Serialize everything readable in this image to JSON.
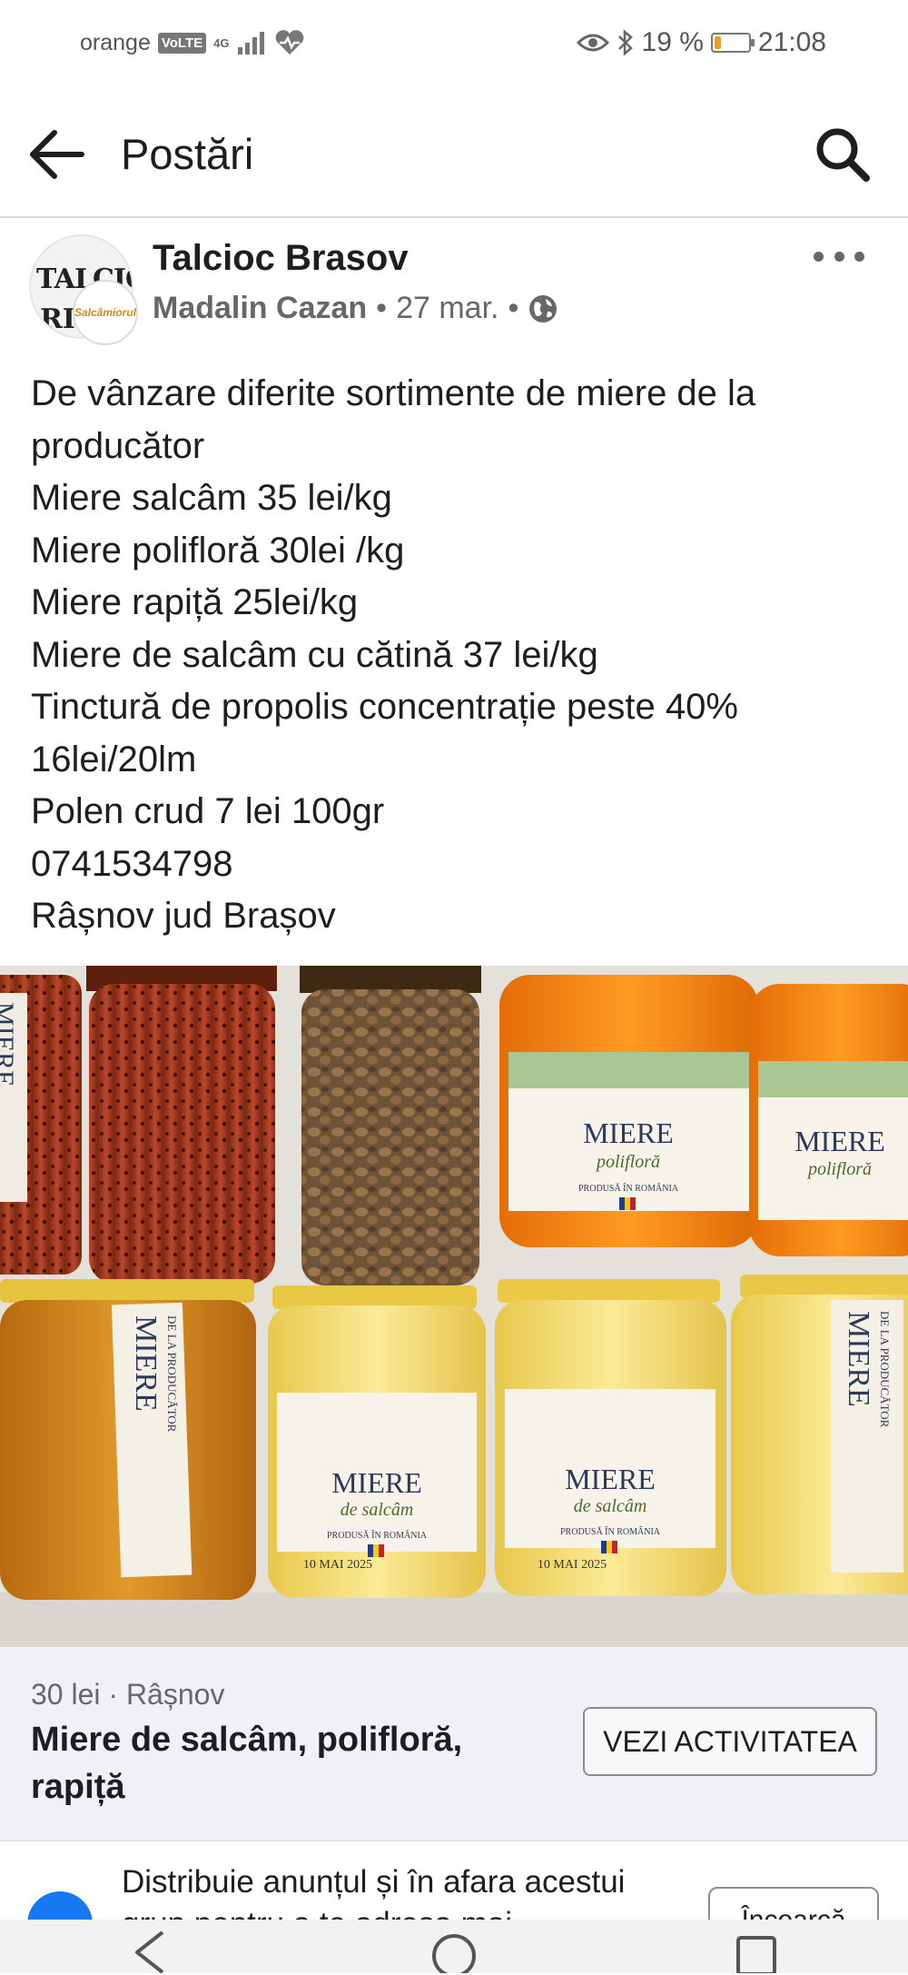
{
  "status_bar": {
    "carrier": "orange",
    "volte": "VoLTE",
    "network": "4G",
    "battery": "19 %",
    "battery_level": 0.19,
    "battery_color": "#e8a11a",
    "time": "21:08"
  },
  "header": {
    "title": "Postări"
  },
  "post": {
    "group_name": "Talcioc Brasov",
    "author": "Madalin Cazan",
    "date": "27 mar.",
    "avatar_text_1": "TALCIO",
    "avatar_text_2": "RI",
    "avatar_small_text": "Salcâmiorul",
    "lines": [
      "De vânzare diferite sortimente de miere de la",
      "producător",
      "Miere salcâm 35 lei/kg",
      "Miere polifloră 30lei /kg",
      "Miere rapiță 25lei/kg",
      "Miere de salcâm cu cătină 37 lei/kg",
      "Tinctură de propolis concentrație peste 40%",
      "16lei/20lm",
      "Polen crud 7 lei 100gr",
      "0741534798",
      "Râșnov jud Brașov"
    ]
  },
  "photo": {
    "jar_labels": {
      "brand": "MIERE",
      "polyflora": "polifloră",
      "acacia": "de salcâm",
      "origin": "PRODUSĂ ÎN ROMÂNIA",
      "side_tag": "MIERE",
      "side_tag_sub": "DE LA PRODUCĂTOR",
      "date": "10 MAI 2025"
    }
  },
  "listing": {
    "price_location": "30 lei · Râșnov",
    "title": "Miere  de salcâm, polifloră, rapiță",
    "activity_button": "VEZI ACTIVITATEA"
  },
  "share": {
    "text": "Distribuie anunțul și în afara acestui grup pentru a te adresa mai",
    "button": "Încearcă"
  },
  "colors": {
    "accent": "#1877f2",
    "secondary_text": "#65676b",
    "listing_bg": "#f0f1f4"
  }
}
